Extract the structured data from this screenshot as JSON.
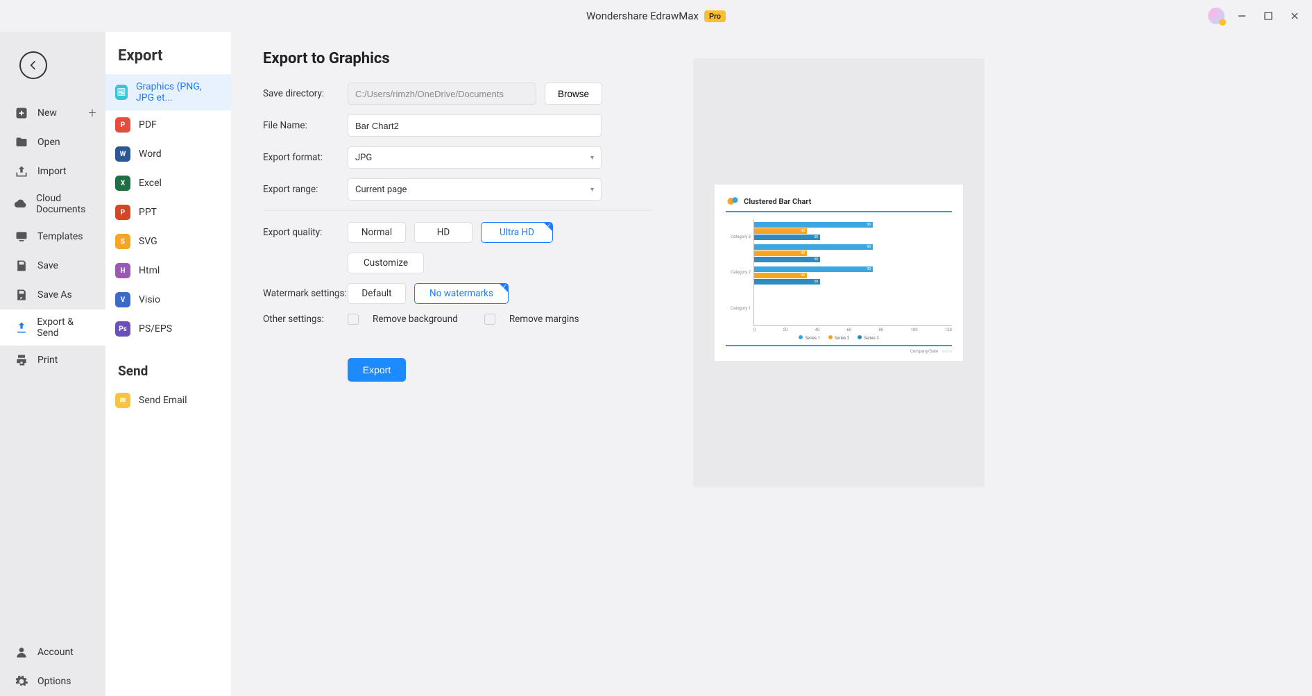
{
  "titlebar": {
    "title": "Wondershare EdrawMax",
    "badge": "Pro"
  },
  "nav": {
    "new": "New",
    "open": "Open",
    "import": "Import",
    "cloud": "Cloud Documents",
    "templates": "Templates",
    "save": "Save",
    "saveas": "Save As",
    "export": "Export & Send",
    "print": "Print",
    "account": "Account",
    "options": "Options"
  },
  "export_panel": {
    "heading": "Export",
    "send_heading": "Send",
    "formats": {
      "graphics": "Graphics (PNG, JPG et...",
      "pdf": "PDF",
      "word": "Word",
      "excel": "Excel",
      "ppt": "PPT",
      "svg": "SVG",
      "html": "Html",
      "visio": "Visio",
      "pseps": "PS/EPS"
    },
    "send_email": "Send Email"
  },
  "form": {
    "title": "Export to Graphics",
    "labels": {
      "save_dir": "Save directory:",
      "file_name": "File Name:",
      "format": "Export format:",
      "range": "Export range:",
      "quality": "Export quality:",
      "watermark": "Watermark settings:",
      "other": "Other settings:"
    },
    "save_dir": "C:/Users/rimzh/OneDrive/Documents",
    "browse": "Browse",
    "file_name": "Bar Chart2",
    "format": "JPG",
    "range": "Current page",
    "quality": {
      "normal": "Normal",
      "hd": "HD",
      "ultra": "Ultra HD",
      "customize": "Customize"
    },
    "watermark": {
      "default": "Default",
      "none": "No watermarks"
    },
    "other": {
      "remove_bg": "Remove background",
      "remove_margins": "Remove margins"
    },
    "export_btn": "Export"
  },
  "chart_data": {
    "type": "bar",
    "orientation": "horizontal",
    "title": "Clustered Bar Chart",
    "categories": [
      "Category 3",
      "Category 2",
      "Category 1"
    ],
    "series": [
      {
        "name": "Series 1",
        "values": [
          90,
          90,
          90
        ],
        "color": "#3ba7e0"
      },
      {
        "name": "Series 2",
        "values": [
          40,
          40,
          40
        ],
        "color": "#f5a623"
      },
      {
        "name": "Series 3",
        "values": [
          50,
          50,
          50
        ],
        "color": "#2e8bc0"
      }
    ],
    "x_ticks": [
      0,
      20,
      40,
      60,
      80,
      100,
      120
    ],
    "xlim": [
      0,
      150
    ],
    "footer": "Company/Date"
  }
}
